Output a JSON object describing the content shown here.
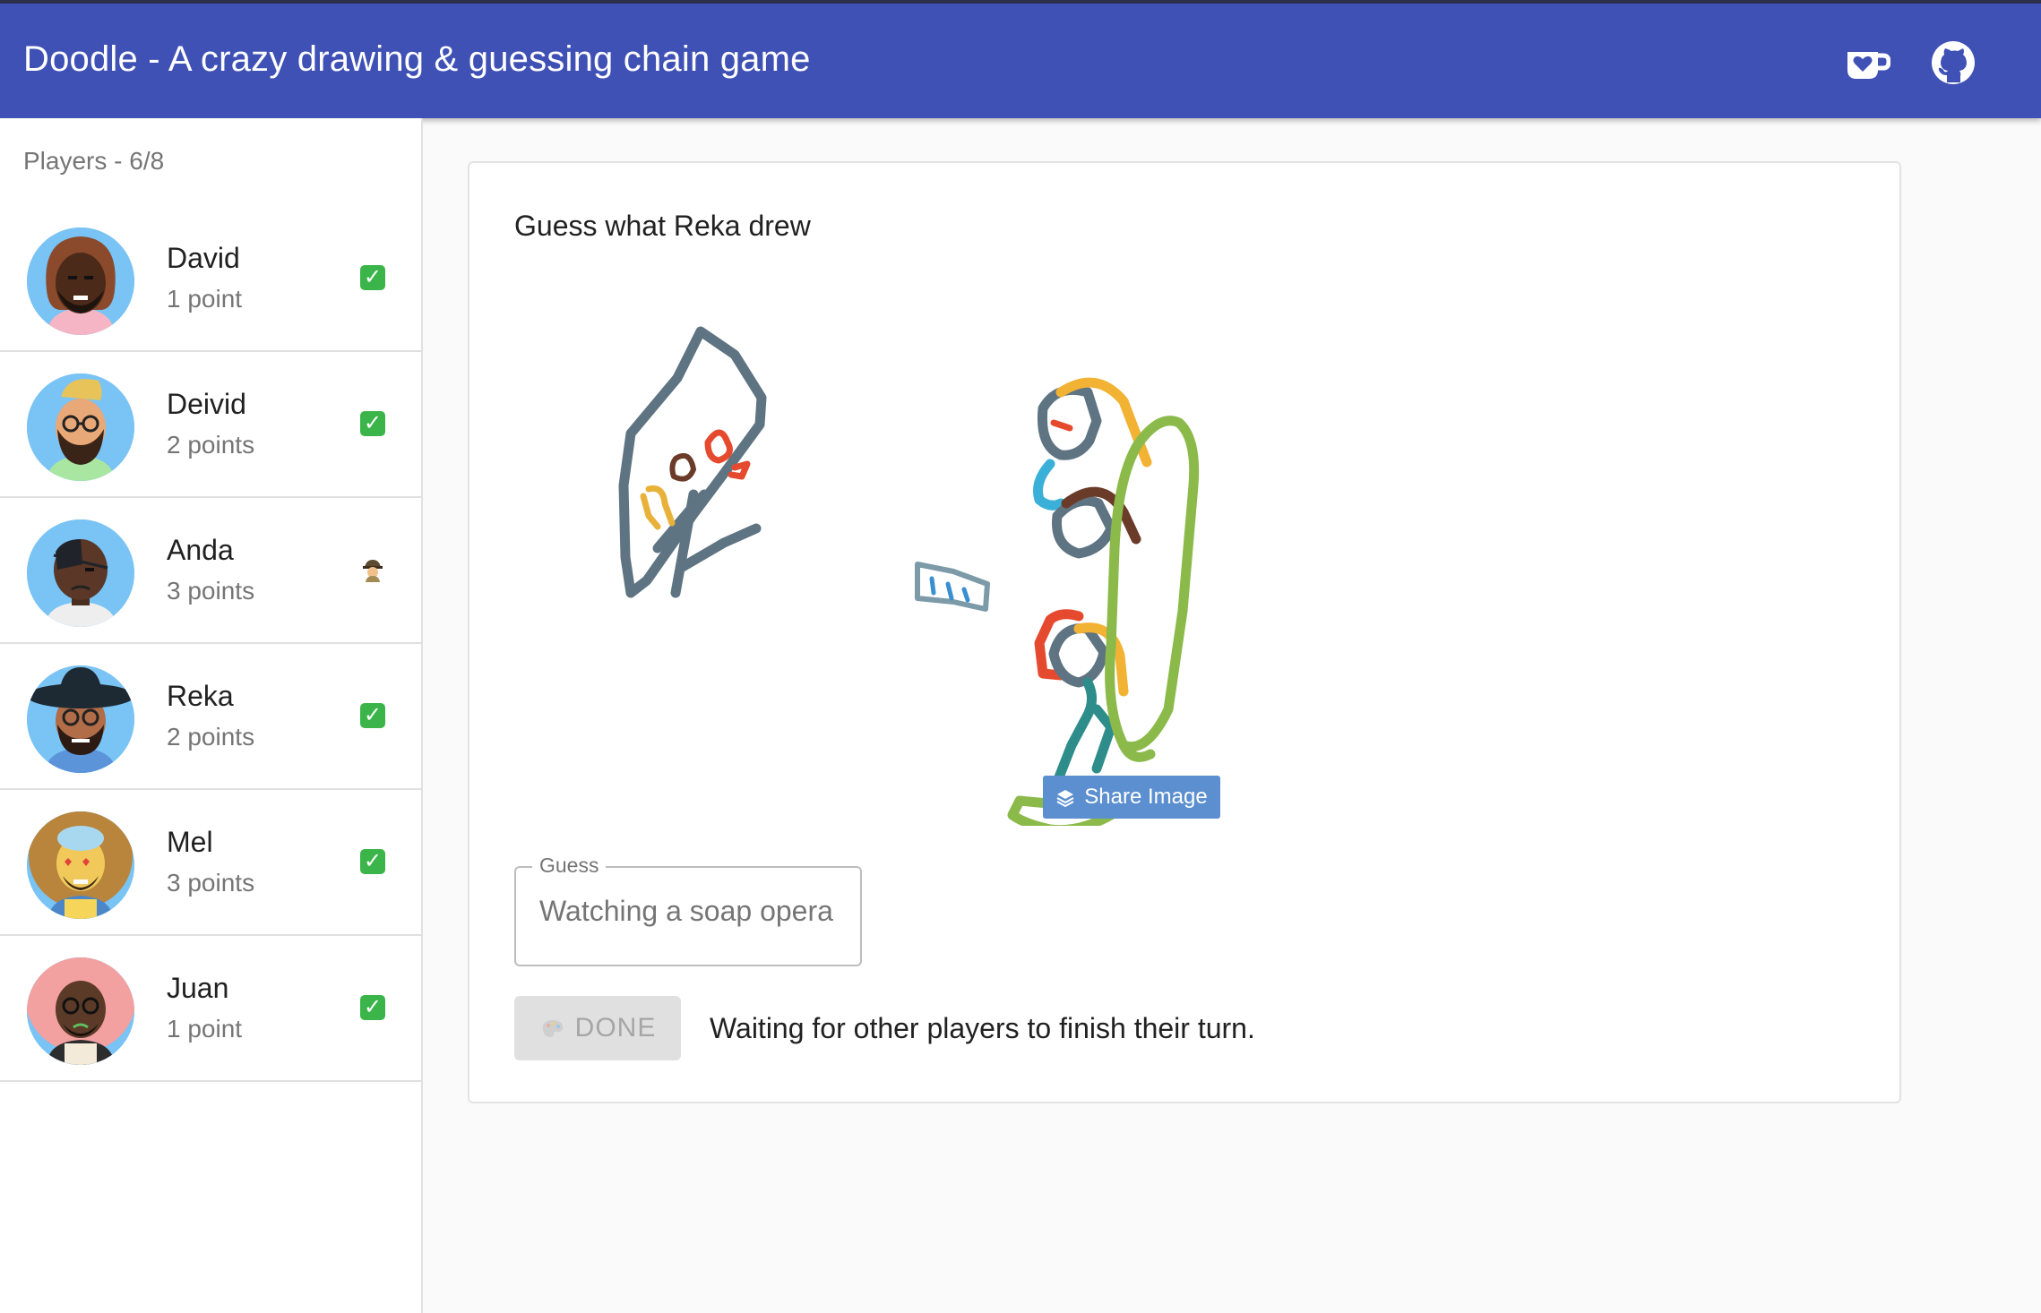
{
  "app": {
    "title": "Doodle - A crazy drawing & guessing chain game",
    "icons": [
      "coffee-heart-icon",
      "github-icon"
    ]
  },
  "sidebar": {
    "header": "Players - 6/8",
    "players": [
      {
        "name": "David",
        "points": "1 point",
        "status": "done",
        "status_icon": "check-icon"
      },
      {
        "name": "Deivid",
        "points": "2 points",
        "status": "done",
        "status_icon": "check-icon"
      },
      {
        "name": "Anda",
        "points": "3 points",
        "status": "working",
        "status_icon": "detective-icon"
      },
      {
        "name": "Reka",
        "points": "2 points",
        "status": "done",
        "status_icon": "check-icon"
      },
      {
        "name": "Mel",
        "points": "3 points",
        "status": "done",
        "status_icon": "check-icon"
      },
      {
        "name": "Juan",
        "points": "1 point",
        "status": "done",
        "status_icon": "check-icon"
      }
    ]
  },
  "main": {
    "prompt": "Guess what Reka drew",
    "share_label": "Share Image",
    "guess": {
      "legend": "Guess",
      "placeholder": "Watching a soap opera",
      "value": ""
    },
    "done_label": "DONE",
    "status_text": "Waiting for other players to finish their turn."
  },
  "colors": {
    "appbar": "#3f51b5",
    "check": "#3bb54a",
    "share_button": "#5b8fcf"
  }
}
